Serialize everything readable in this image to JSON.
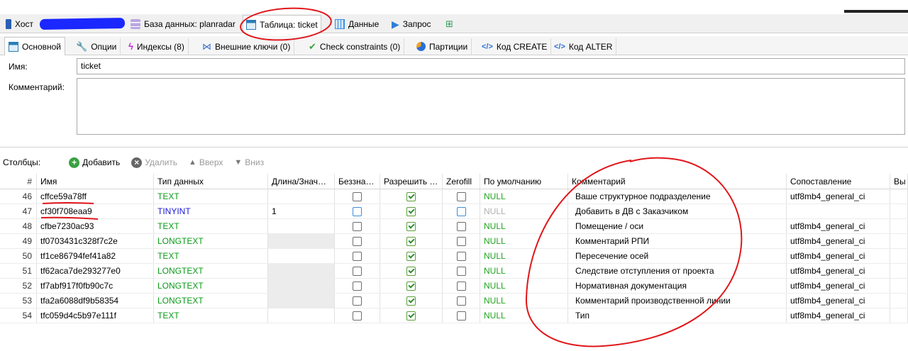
{
  "top_tabs": [
    {
      "label": "Хост",
      "icon": "server-icon"
    },
    {
      "label": "База данных: planradar",
      "icon": "database-icon"
    },
    {
      "label": "Таблица: ticket",
      "icon": "table-icon"
    },
    {
      "label": "Данные",
      "icon": "grid-icon"
    },
    {
      "label": "Запрос",
      "icon": "play-icon"
    }
  ],
  "sub_tabs": [
    {
      "label": "Основной",
      "icon": "table-icon"
    },
    {
      "label": "Опции",
      "icon": "wrench-icon"
    },
    {
      "label": "Индексы (8)",
      "icon": "lightning-icon"
    },
    {
      "label": "Внешние ключи (0)",
      "icon": "foreign-key-icon"
    },
    {
      "label": "Check constraints (0)",
      "icon": "check-icon"
    },
    {
      "label": "Партиции",
      "icon": "pie-icon"
    },
    {
      "label": "Код CREATE",
      "icon": "code-icon"
    },
    {
      "label": "Код ALTER",
      "icon": "code-icon"
    }
  ],
  "form": {
    "name_label": "Имя:",
    "name_value": "ticket",
    "comment_label": "Комментарий:",
    "comment_value": ""
  },
  "toolbar": {
    "columns_label": "Столбцы:",
    "add": "Добавить",
    "remove": "Удалить",
    "up": "Вверх",
    "down": "Вниз"
  },
  "columns": {
    "headers": [
      "#",
      "Имя",
      "Тип данных",
      "Длина/Знач…",
      "Беззна…",
      "Разрешить …",
      "Zerofill",
      "По умолчанию",
      "Комментарий",
      "Сопоставление",
      "Вы"
    ],
    "rows": [
      {
        "num": "46",
        "name": "cffce59a78ff",
        "type": "TEXT",
        "length": "",
        "unsigned": "unchecked",
        "allow_null": true,
        "zerofill": "unchecked",
        "default": "NULL",
        "comment": "Ваше структурное подразделение",
        "collation": "utf8mb4_general_ci"
      },
      {
        "num": "47",
        "name": "cf30f708eaa9",
        "type": "TINYINT",
        "length": "1",
        "unsigned": "blue",
        "allow_null": true,
        "zerofill": "blue",
        "default": "NULL",
        "comment": "Добавить в ДВ с Заказчиком",
        "collation": ""
      },
      {
        "num": "48",
        "name": "cfbe7230ac93",
        "type": "TEXT",
        "length": "",
        "unsigned": "unchecked",
        "allow_null": true,
        "zerofill": "unchecked",
        "default": "NULL",
        "comment": "Помещение / оси",
        "collation": "utf8mb4_general_ci"
      },
      {
        "num": "49",
        "name": "tf0703431c328f7c2e",
        "type": "LONGTEXT",
        "length": "",
        "unsigned": "unchecked",
        "allow_null": true,
        "zerofill": "unchecked",
        "default": "NULL",
        "comment": "Комментарий РПИ",
        "collation": "utf8mb4_general_ci"
      },
      {
        "num": "50",
        "name": "tf1ce86794fef41a82",
        "type": "TEXT",
        "length": "",
        "unsigned": "unchecked",
        "allow_null": true,
        "zerofill": "unchecked",
        "default": "NULL",
        "comment": "Пересечение осей",
        "collation": "utf8mb4_general_ci"
      },
      {
        "num": "51",
        "name": "tf62aca7de293277e0",
        "type": "LONGTEXT",
        "length": "",
        "unsigned": "unchecked",
        "allow_null": true,
        "zerofill": "unchecked",
        "default": "NULL",
        "comment": "Следствие отступления от проекта",
        "collation": "utf8mb4_general_ci"
      },
      {
        "num": "52",
        "name": "tf7abf917f0fb90c7c",
        "type": "LONGTEXT",
        "length": "",
        "unsigned": "unchecked",
        "allow_null": true,
        "zerofill": "unchecked",
        "default": "NULL",
        "comment": "Нормативная документация",
        "collation": "utf8mb4_general_ci"
      },
      {
        "num": "53",
        "name": "tfa2a6088df9b58354",
        "type": "LONGTEXT",
        "length": "",
        "unsigned": "unchecked",
        "allow_null": true,
        "zerofill": "unchecked",
        "default": "NULL",
        "comment": "Комментарий производственной линии",
        "collation": "utf8mb4_general_ci"
      },
      {
        "num": "54",
        "name": "tfc059d4c5b97e111f",
        "type": "TEXT",
        "length": "",
        "unsigned": "unchecked",
        "allow_null": true,
        "zerofill": "unchecked",
        "default": "NULL",
        "comment": "Тип",
        "collation": "utf8mb4_general_ci"
      }
    ]
  },
  "colors": {
    "type_text": "#0a9b17",
    "type_int": "#1919d8",
    "annotation": "#e0161a",
    "redaction": "#1b27ff"
  }
}
